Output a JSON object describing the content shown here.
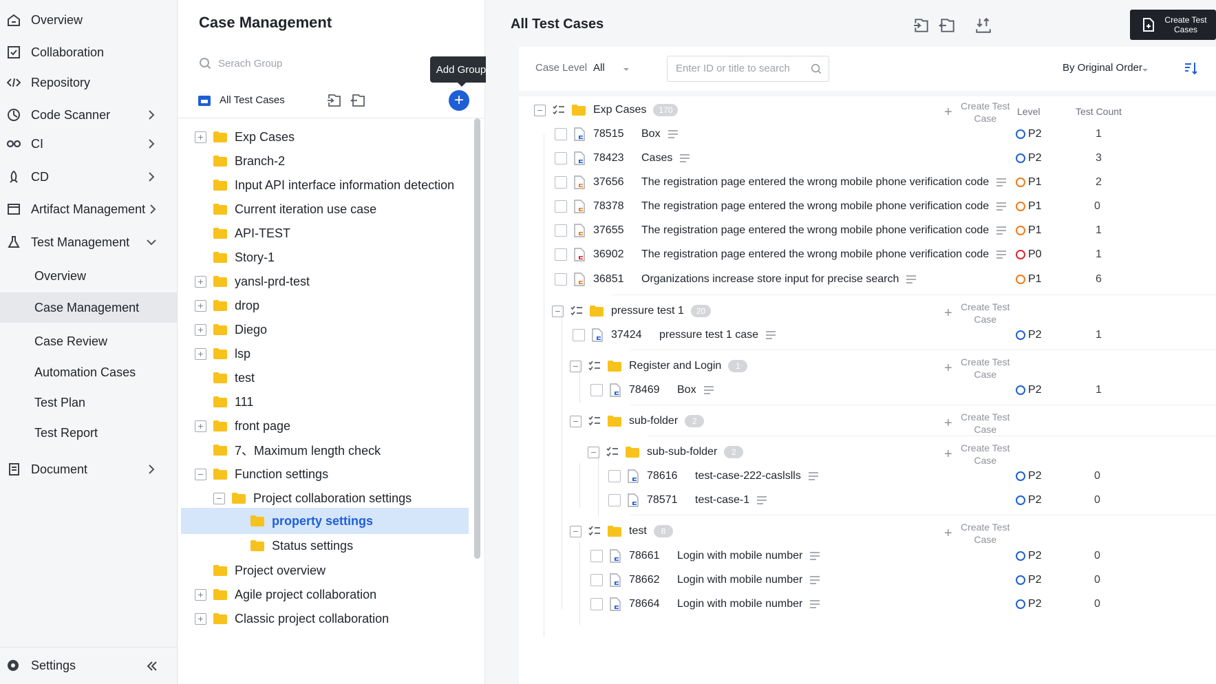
{
  "nav": {
    "items": [
      {
        "label": "Overview",
        "icon": "home-icon"
      },
      {
        "label": "Collaboration",
        "icon": "check-square-icon"
      },
      {
        "label": "Repository",
        "icon": "code-icon"
      },
      {
        "label": "Code Scanner",
        "icon": "scanner-icon"
      },
      {
        "label": "CI",
        "icon": "infinity-icon"
      },
      {
        "label": "CD",
        "icon": "rocket-icon"
      },
      {
        "label": "Artifact Management",
        "icon": "box-icon"
      },
      {
        "label": "Test Management",
        "icon": "flask-icon"
      }
    ],
    "sub_items": [
      "Overview",
      "Case Management",
      "Case Review",
      "Automation Cases",
      "Test Plan",
      "Test Report"
    ],
    "document": "Document",
    "settings": "Settings"
  },
  "groups": {
    "title": "Case Management",
    "search_placeholder": "Serach Group",
    "tooltip": "Add Group",
    "all_label": "All Test Cases",
    "tree": [
      {
        "label": "Exp Cases",
        "expander": "+",
        "indent": 0
      },
      {
        "label": "Branch-2",
        "expander": "",
        "indent": 0
      },
      {
        "label": "Input API interface information detection",
        "expander": "",
        "indent": 0
      },
      {
        "label": "Current iteration use case",
        "expander": "",
        "indent": 0
      },
      {
        "label": "API-TEST",
        "expander": "",
        "indent": 0
      },
      {
        "label": "Story-1",
        "expander": "",
        "indent": 0
      },
      {
        "label": "yansl-prd-test",
        "expander": "+",
        "indent": 0
      },
      {
        "label": "drop",
        "expander": "+",
        "indent": 0
      },
      {
        "label": "Diego",
        "expander": "+",
        "indent": 0
      },
      {
        "label": "lsp",
        "expander": "+",
        "indent": 0
      },
      {
        "label": "test",
        "expander": "",
        "indent": 0
      },
      {
        "label": "111",
        "expander": "",
        "indent": 0
      },
      {
        "label": "front page",
        "expander": "+",
        "indent": 0
      },
      {
        "label": "7、Maximum length check",
        "expander": "",
        "indent": 0
      },
      {
        "label": "Function settings",
        "expander": "−",
        "indent": 0
      },
      {
        "label": "Project collaboration settings",
        "expander": "−",
        "indent": 1
      },
      {
        "label": "property settings",
        "expander": "",
        "indent": 2,
        "selected": true
      },
      {
        "label": "Status settings",
        "expander": "",
        "indent": 2
      },
      {
        "label": "Project overview",
        "expander": "",
        "indent": 0
      },
      {
        "label": "Agile project collaboration",
        "expander": "+",
        "indent": 0
      },
      {
        "label": "Classic project collaboration",
        "expander": "+",
        "indent": 0
      }
    ]
  },
  "main": {
    "title": "All Test Cases",
    "create_button": "Create Test Cases",
    "filter": {
      "level_label": "Case Level",
      "level_value": "All",
      "search_placeholder": "Enter ID or title to search",
      "order": "By Original Order"
    },
    "columns": {
      "level": "Level",
      "count": "Test Count"
    },
    "create_case": "Create Test Case",
    "rows": [
      {
        "kind": "group",
        "name": "Exp Cases",
        "count": "170",
        "depth": 0
      },
      {
        "kind": "case",
        "id": "78515",
        "title": "Box",
        "level": "P2",
        "test_count": "1",
        "depth": 0
      },
      {
        "kind": "case",
        "id": "78423",
        "title": "Cases",
        "level": "P2",
        "test_count": "3",
        "depth": 0
      },
      {
        "kind": "case",
        "id": "37656",
        "title": "The registration page entered the wrong mobile phone verification code",
        "level": "P1",
        "test_count": "2",
        "depth": 0
      },
      {
        "kind": "case",
        "id": "78378",
        "title": "The registration page entered the wrong mobile phone verification code",
        "level": "P1",
        "test_count": "0",
        "depth": 0
      },
      {
        "kind": "case",
        "id": "37655",
        "title": "The registration page entered the wrong mobile phone verification code",
        "level": "P1",
        "test_count": "1",
        "depth": 0
      },
      {
        "kind": "case",
        "id": "36902",
        "title": "The registration page entered the wrong mobile phone verification code",
        "level": "P0",
        "test_count": "1",
        "depth": 0
      },
      {
        "kind": "case",
        "id": "36851",
        "title": "Organizations increase store input for precise search",
        "level": "P1",
        "test_count": "6",
        "depth": 0
      },
      {
        "kind": "group",
        "name": "pressure test 1",
        "count": "20",
        "depth": 1
      },
      {
        "kind": "case",
        "id": "37424",
        "title": "pressure test 1 case",
        "level": "P2",
        "test_count": "1",
        "depth": 1
      },
      {
        "kind": "group",
        "name": "Register and Login",
        "count": "1",
        "depth": 2
      },
      {
        "kind": "case",
        "id": "78469",
        "title": "Box",
        "level": "P2",
        "test_count": "1",
        "depth": 2
      },
      {
        "kind": "group",
        "name": "sub-folder",
        "count": "2",
        "depth": 2
      },
      {
        "kind": "group",
        "name": "sub-sub-folder",
        "count": "2",
        "depth": 3
      },
      {
        "kind": "case",
        "id": "78616",
        "title": "test-case-222-caslslls",
        "level": "P2",
        "test_count": "0",
        "depth": 3
      },
      {
        "kind": "case",
        "id": "78571",
        "title": "test-case-1",
        "level": "P2",
        "test_count": "0",
        "depth": 3
      },
      {
        "kind": "group",
        "name": "test",
        "count": "8",
        "depth": 2
      },
      {
        "kind": "case",
        "id": "78661",
        "title": "Login with mobile number",
        "level": "P2",
        "test_count": "0",
        "depth": 2
      },
      {
        "kind": "case",
        "id": "78662",
        "title": "Login with mobile number",
        "level": "P2",
        "test_count": "0",
        "depth": 2
      },
      {
        "kind": "case",
        "id": "78664",
        "title": "Login with mobile number",
        "level": "P2",
        "test_count": "0",
        "depth": 2
      }
    ]
  },
  "colors": {
    "accent": "#1f5fd6",
    "folder": "#f8c21c",
    "p0": "#e0242c",
    "p1": "#f07b1b",
    "p2": "#1f5fd6"
  }
}
